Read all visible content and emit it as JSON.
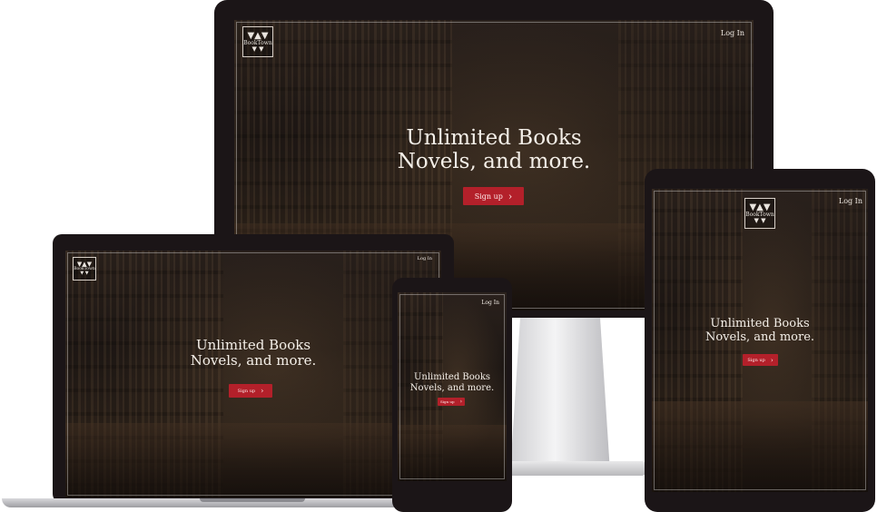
{
  "logo": {
    "text": "BookTown"
  },
  "nav": {
    "login_label": "Log In"
  },
  "hero": {
    "line1": "Unlimited Books",
    "line2": "Novels, and more.",
    "cta_label": "Sign up"
  },
  "icons": {
    "cta": "chevron-right-icon",
    "logo": "booktown-logo-icon"
  },
  "colors": {
    "cta": "#b3202a",
    "device_frame": "#1b1517"
  }
}
